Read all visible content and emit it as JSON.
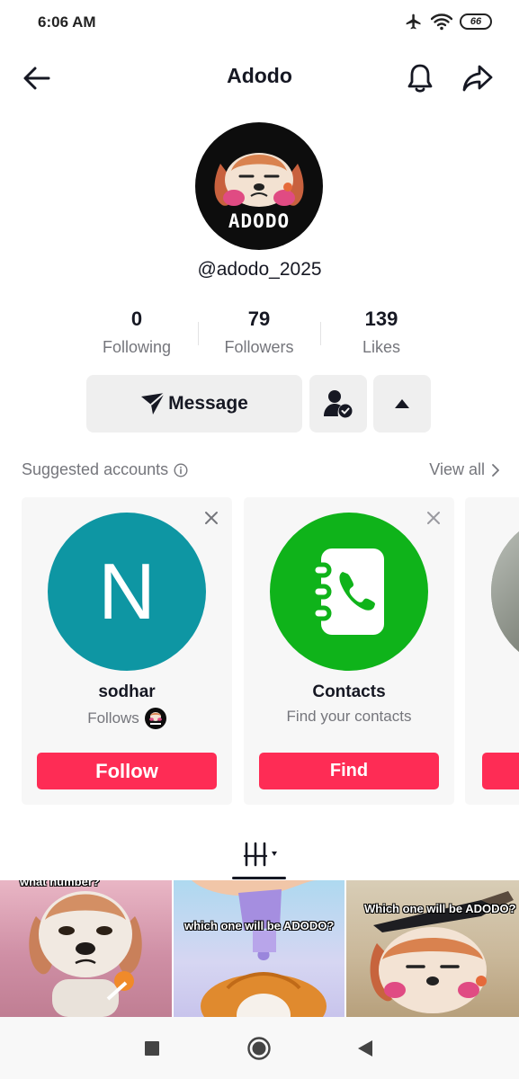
{
  "status_bar": {
    "time": "6:06 AM",
    "battery": "66",
    "icons": [
      "airplane-icon",
      "wifi-icon",
      "battery-icon"
    ]
  },
  "header": {
    "title": "Adodo",
    "icons": [
      "back-arrow-icon",
      "bell-icon",
      "share-icon"
    ]
  },
  "profile": {
    "avatar_text": "ADODO",
    "username": "@adodo_2025",
    "stats": [
      {
        "value": "0",
        "label": "Following"
      },
      {
        "value": "79",
        "label": "Followers"
      },
      {
        "value": "139",
        "label": "Likes"
      }
    ]
  },
  "actions": {
    "message_label": "Message",
    "icons": [
      "send-icon",
      "friends-icon",
      "caret-up-icon"
    ]
  },
  "suggested": {
    "title": "Suggested accounts",
    "view_all": "View all",
    "cards": [
      {
        "initial": "N",
        "name": "sodhar",
        "subtitle": "Follows",
        "button": "Follow",
        "avatar_color": "#0e96a3"
      },
      {
        "name": "Contacts",
        "subtitle": "Find your contacts",
        "button": "Find",
        "avatar_color": "#0fb31a"
      }
    ]
  },
  "videos": {
    "captions": [
      "what number?",
      "which one will be ADODO?",
      "Which one will be ADODO?"
    ]
  },
  "colors": {
    "accent": "#fe2c55",
    "text_primary": "#161823",
    "text_secondary": "#75767c",
    "button_bg": "#efefef"
  }
}
